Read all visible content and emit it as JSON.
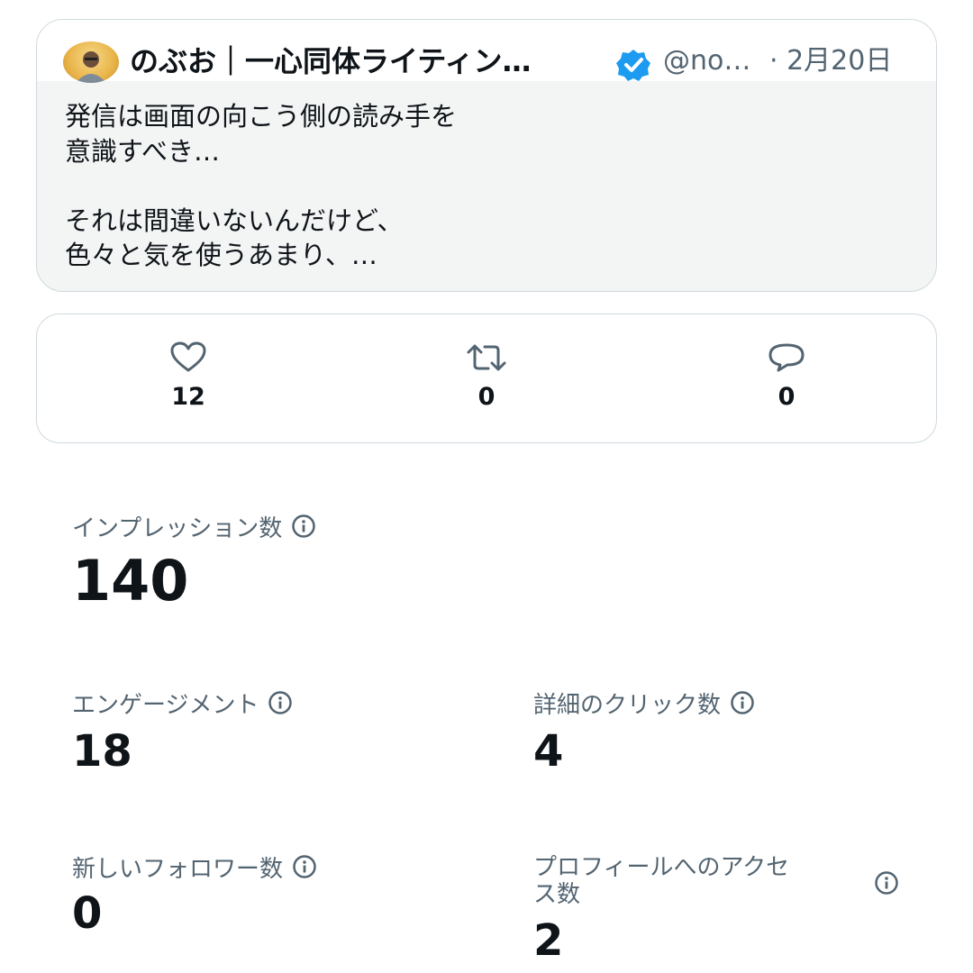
{
  "tweet": {
    "author_name": "のぶお｜一心同体ライティン…",
    "handle": "@no…",
    "date": "· 2月20日",
    "text": "発信は画面の向こう側の読み手を\n意識すべき…\n\nそれは間違いないんだけど、\n色々と気を使うあまり、…"
  },
  "actions": {
    "likes": "12",
    "retweets": "0",
    "replies": "0"
  },
  "metrics": {
    "impressions": {
      "label": "インプレッション数",
      "value": "140"
    },
    "engagements": {
      "label": "エンゲージメント",
      "value": "18"
    },
    "detail_clicks": {
      "label": "詳細のクリック数",
      "value": "4"
    },
    "new_followers": {
      "label": "新しいフォロワー数",
      "value": "0"
    },
    "profile_visits": {
      "label": "プロフィールへのアクセ\nス数",
      "value": "2"
    }
  },
  "colors": {
    "verified_blue": "#1d9bf0",
    "secondary_text": "#536471",
    "border": "#cfd9de"
  }
}
